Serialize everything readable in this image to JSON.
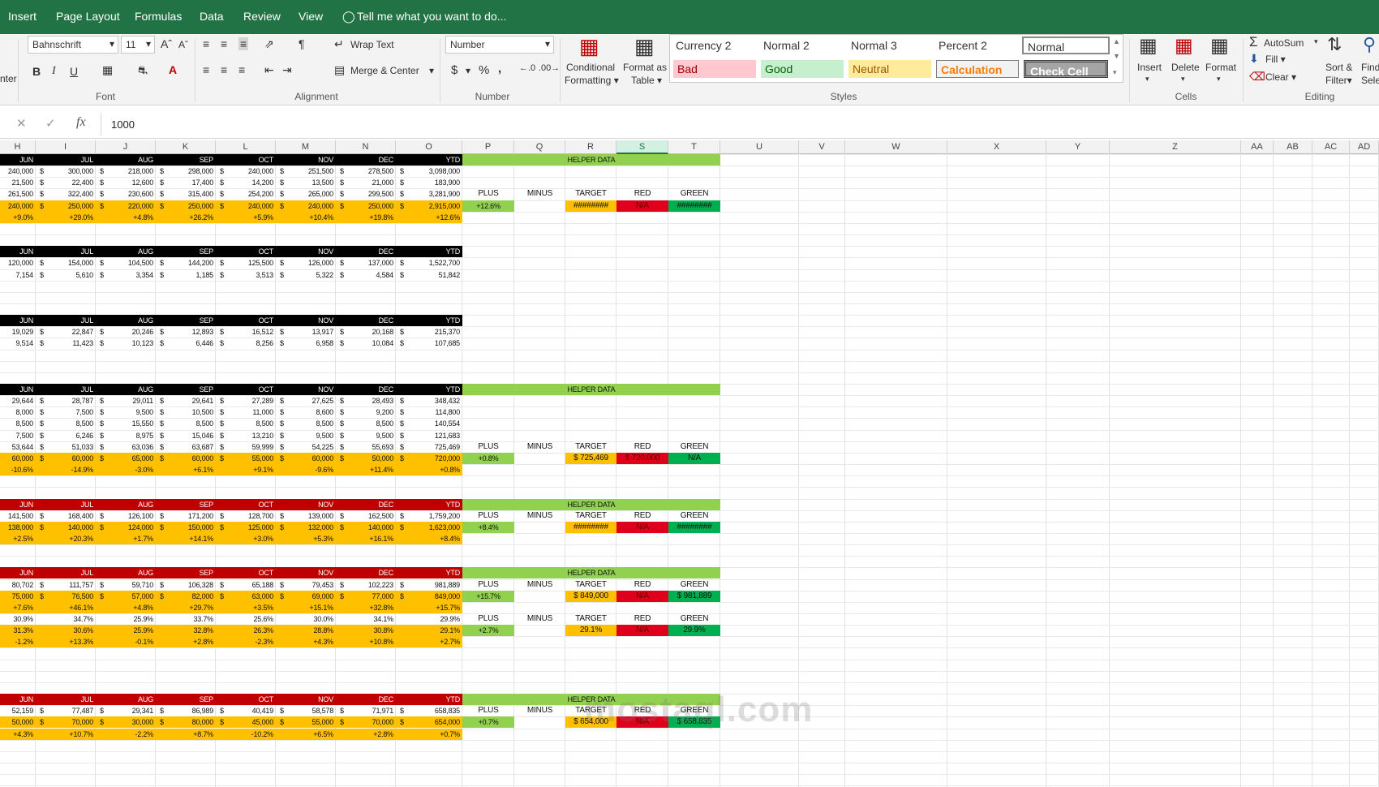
{
  "tabs": [
    "Insert",
    "Page Layout",
    "Formulas",
    "Data",
    "Review",
    "View"
  ],
  "tell_me": "Tell me what you want to do...",
  "ribbon": {
    "clip_label": "nter",
    "font_name": "Bahnschrift",
    "font_size": "11",
    "font_group": "Font",
    "wrap_text": "Wrap Text",
    "merge_center": "Merge & Center",
    "alignment_group": "Alignment",
    "number_format": "Number",
    "dollar": "$",
    "percent": "%",
    "comma": ",",
    "number_group": "Number",
    "cond_fmt_1": "Conditional",
    "cond_fmt_2": "Formatting",
    "fmt_table_1": "Format as",
    "fmt_table_2": "Table",
    "styles_group": "Styles",
    "styles": [
      {
        "label": "Currency 2",
        "bg": "#ffffff",
        "fg": "#222222"
      },
      {
        "label": "Normal 2",
        "bg": "#ffffff",
        "fg": "#222222"
      },
      {
        "label": "Normal 3",
        "bg": "#ffffff",
        "fg": "#222222"
      },
      {
        "label": "Percent 2",
        "bg": "#ffffff",
        "fg": "#222222"
      },
      {
        "label": "Normal",
        "bg": "#ffffff",
        "fg": "#222222"
      },
      {
        "label": "Bad",
        "bg": "#ffc7ce",
        "fg": "#9c0006"
      },
      {
        "label": "Good",
        "bg": "#c6efce",
        "fg": "#006100"
      },
      {
        "label": "Neutral",
        "bg": "#ffeb9c",
        "fg": "#9c5700"
      },
      {
        "label": "Calculation",
        "bg": "#f2f2f2",
        "fg": "#fa7d00"
      },
      {
        "label": "Check Cell",
        "bg": "#a5a5a5",
        "fg": "#ffffff"
      }
    ],
    "insert": "Insert",
    "delete": "Delete",
    "format": "Format",
    "cells_group": "Cells",
    "autosum": "AutoSum",
    "fill": "Fill",
    "clear": "Clear",
    "sort_1": "Sort &",
    "sort_2": "Filter",
    "find_1": "Find",
    "find_2": "Selec",
    "editing_group": "Editing"
  },
  "formula": {
    "fx": "fx",
    "value": "1000"
  },
  "columns": [
    "H",
    "I",
    "J",
    "K",
    "L",
    "M",
    "N",
    "O",
    "P",
    "Q",
    "R",
    "S",
    "T",
    "U",
    "V",
    "W",
    "X",
    "Y",
    "Z",
    "AA",
    "AB",
    "AC",
    "AD"
  ],
  "selected_column": "S",
  "months": [
    "JUN",
    "JUL",
    "AUG",
    "SEP",
    "OCT",
    "NOV",
    "DEC",
    "YTD"
  ],
  "helper_label": "HELPER DATA",
  "helper_cols": [
    "PLUS",
    "MINUS",
    "TARGET",
    "RED",
    "GREEN"
  ],
  "colors": {
    "black": "#000000",
    "red": "#c00000",
    "orange": "#ffc000",
    "green": "#92d050",
    "gr_dark": "#00b050",
    "red_cell": "#e0001b",
    "excel_green": "#217346"
  },
  "blocks": [
    {
      "header": "black",
      "rows": [
        {
          "style": "plain",
          "dollar": true,
          "values": [
            "240,000",
            "300,000",
            "218,000",
            "298,000",
            "240,000",
            "251,500",
            "278,500",
            "3,098,000"
          ]
        },
        {
          "style": "plain",
          "dollar": true,
          "values": [
            "21,500",
            "22,400",
            "12,600",
            "17,400",
            "14,200",
            "13,500",
            "21,000",
            "183,900"
          ]
        },
        {
          "style": "plain",
          "dollar": true,
          "values": [
            "261,500",
            "322,400",
            "230,600",
            "315,400",
            "254,200",
            "265,000",
            "299,500",
            "3,281,900"
          ]
        },
        {
          "style": "orange",
          "dollar": true,
          "values": [
            "240,000",
            "250,000",
            "220,000",
            "250,000",
            "240,000",
            "240,000",
            "250,000",
            "2,915,000"
          ]
        },
        {
          "style": "orange",
          "dollar": false,
          "values": [
            "+9.0%",
            "+29.0%",
            "+4.8%",
            "+26.2%",
            "+5.9%",
            "+10.4%",
            "+19.8%",
            "+12.6%"
          ]
        }
      ],
      "helper": {
        "header_row": 0,
        "groups": [
          {
            "label_row": 3,
            "plus": "+12.6%",
            "minus": "",
            "target": "########",
            "red": "N/A",
            "green": "########",
            "target_bg": "orange",
            "red_bg": "red_cell",
            "green_bg": "gr_dark"
          }
        ]
      }
    },
    {
      "header": "black",
      "rows": [
        {
          "style": "plain",
          "dollar": true,
          "values": [
            "120,000",
            "154,000",
            "104,500",
            "144,200",
            "125,500",
            "126,000",
            "137,000",
            "1,522,700"
          ]
        },
        {
          "style": "plain",
          "dollar": true,
          "values": [
            "7,154",
            "5,610",
            "3,354",
            "1,185",
            "3,513",
            "5,322",
            "4,584",
            "51,842"
          ]
        }
      ]
    },
    {
      "header": "black",
      "rows": [
        {
          "style": "plain",
          "dollar": true,
          "values": [
            "19,029",
            "22,847",
            "20,246",
            "12,893",
            "16,512",
            "13,917",
            "20,168",
            "215,370"
          ]
        },
        {
          "style": "plain",
          "dollar": true,
          "values": [
            "9,514",
            "11,423",
            "10,123",
            "6,446",
            "8,256",
            "6,958",
            "10,084",
            "107,685"
          ]
        }
      ]
    },
    {
      "header": "black",
      "rows": [
        {
          "style": "plain",
          "dollar": true,
          "values": [
            "29,644",
            "28,787",
            "29,011",
            "29,641",
            "27,289",
            "27,625",
            "28,493",
            "348,432"
          ]
        },
        {
          "style": "plain",
          "dollar": true,
          "values": [
            "8,000",
            "7,500",
            "9,500",
            "10,500",
            "11,000",
            "8,600",
            "9,200",
            "114,800"
          ]
        },
        {
          "style": "plain",
          "dollar": true,
          "values": [
            "8,500",
            "8,500",
            "15,550",
            "8,500",
            "8,500",
            "8,500",
            "8,500",
            "140,554"
          ]
        },
        {
          "style": "plain",
          "dollar": true,
          "values": [
            "7,500",
            "6,246",
            "8,975",
            "15,046",
            "13,210",
            "9,500",
            "9,500",
            "121,683"
          ]
        },
        {
          "style": "plain",
          "dollar": true,
          "values": [
            "53,644",
            "51,033",
            "63,036",
            "63,687",
            "59,999",
            "54,225",
            "55,693",
            "725,469"
          ]
        },
        {
          "style": "orange",
          "dollar": true,
          "values": [
            "60,000",
            "60,000",
            "65,000",
            "60,000",
            "55,000",
            "60,000",
            "50,000",
            "720,000"
          ]
        },
        {
          "style": "orange",
          "dollar": false,
          "values": [
            "-10.6%",
            "-14.9%",
            "-3.0%",
            "+6.1%",
            "+9.1%",
            "-9.6%",
            "+11.4%",
            "+0.8%"
          ]
        }
      ],
      "helper": {
        "header_row": 0,
        "groups": [
          {
            "label_row": 5,
            "plus": "+0.8%",
            "minus": "",
            "target": "$  725,469",
            "red": "$  720,000",
            "green": "N/A",
            "target_bg": "orange",
            "red_bg": "red_cell",
            "green_bg": "gr_dark"
          }
        ]
      }
    },
    {
      "header": "red",
      "rows": [
        {
          "style": "plain",
          "dollar": true,
          "values": [
            "141,500",
            "168,400",
            "126,100",
            "171,200",
            "128,700",
            "139,000",
            "162,500",
            "1,759,200"
          ]
        },
        {
          "style": "orange",
          "dollar": true,
          "values": [
            "138,000",
            "140,000",
            "124,000",
            "150,000",
            "125,000",
            "132,000",
            "140,000",
            "1,623,000"
          ]
        },
        {
          "style": "orange",
          "dollar": false,
          "values": [
            "+2.5%",
            "+20.3%",
            "+1.7%",
            "+14.1%",
            "+3.0%",
            "+5.3%",
            "+16.1%",
            "+8.4%"
          ]
        }
      ],
      "helper": {
        "header_row": 0,
        "groups": [
          {
            "label_row": 1,
            "plus": "+8.4%",
            "minus": "",
            "target": "########",
            "red": "N/A",
            "green": "########",
            "target_bg": "orange",
            "red_bg": "red_cell",
            "green_bg": "gr_dark"
          }
        ]
      }
    },
    {
      "header": "red",
      "rows": [
        {
          "style": "plain",
          "dollar": true,
          "values": [
            "80,702",
            "111,757",
            "59,710",
            "106,328",
            "65,188",
            "79,453",
            "102,223",
            "981,889"
          ]
        },
        {
          "style": "orange",
          "dollar": true,
          "values": [
            "75,000",
            "76,500",
            "57,000",
            "82,000",
            "63,000",
            "69,000",
            "77,000",
            "849,000"
          ]
        },
        {
          "style": "orange",
          "dollar": false,
          "values": [
            "+7.6%",
            "+46.1%",
            "+4.8%",
            "+29.7%",
            "+3.5%",
            "+15.1%",
            "+32.8%",
            "+15.7%"
          ]
        },
        {
          "style": "plain",
          "dollar": false,
          "values": [
            "30.9%",
            "34.7%",
            "25.9%",
            "33.7%",
            "25.6%",
            "30.0%",
            "34.1%",
            "29.9%"
          ]
        },
        {
          "style": "orange",
          "dollar": false,
          "values": [
            "31.3%",
            "30.6%",
            "25.9%",
            "32.8%",
            "26.3%",
            "28.8%",
            "30.8%",
            "29.1%"
          ]
        },
        {
          "style": "orange",
          "dollar": false,
          "values": [
            "-1.2%",
            "+13.3%",
            "-0.1%",
            "+2.8%",
            "-2.3%",
            "+4.3%",
            "+10.8%",
            "+2.7%"
          ]
        }
      ],
      "helper": {
        "header_row": 0,
        "groups": [
          {
            "label_row": 1,
            "plus": "+15.7%",
            "minus": "",
            "target": "$  849,000",
            "red": "N/A",
            "green": "$  981,889",
            "target_bg": "orange",
            "red_bg": "red_cell",
            "green_bg": "gr_dark"
          },
          {
            "label_row": 4,
            "plus": "+2.7%",
            "minus": "",
            "target": "29.1%",
            "red": "N/A",
            "green": "29.9%",
            "target_bg": "orange",
            "red_bg": "red_cell",
            "green_bg": "gr_dark"
          }
        ]
      }
    },
    {
      "header": "red",
      "rows": [
        {
          "style": "plain",
          "dollar": true,
          "values": [
            "52,159",
            "77,487",
            "29,341",
            "86,989",
            "40,419",
            "58,578",
            "71,971",
            "658,835"
          ]
        },
        {
          "style": "orange",
          "dollar": true,
          "values": [
            "50,000",
            "70,000",
            "30,000",
            "80,000",
            "45,000",
            "55,000",
            "70,000",
            "654,000"
          ]
        },
        {
          "style": "orange",
          "dollar": false,
          "values": [
            "+4.3%",
            "+10.7%",
            "-2.2%",
            "+8.7%",
            "-10.2%",
            "+6.5%",
            "+2.8%",
            "+0.7%"
          ]
        }
      ],
      "helper": {
        "header_row": 0,
        "groups": [
          {
            "label_row": 1,
            "plus": "+0.7%",
            "minus": "",
            "target": "$  654,000",
            "red": "N/A",
            "green": "$  658,835",
            "target_bg": "orange",
            "red_bg": "red_cell",
            "green_bg": "gr_dark"
          }
        ]
      }
    }
  ]
}
